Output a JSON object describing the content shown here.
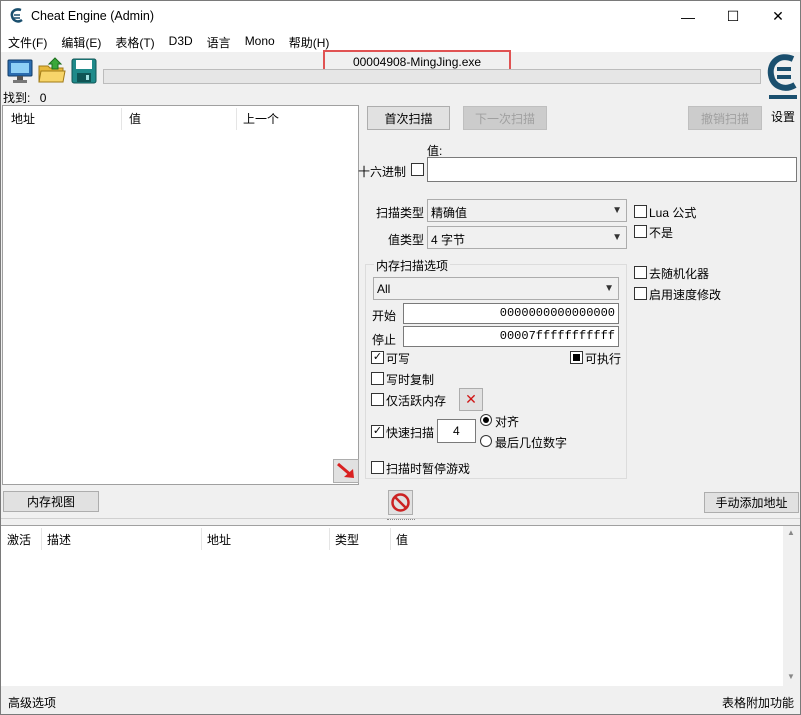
{
  "window": {
    "title": "Cheat Engine (Admin)",
    "minimize": "—",
    "maximize": "☐",
    "close": "✕"
  },
  "menu": [
    "文件(F)",
    "编辑(E)",
    "表格(T)",
    "D3D",
    "语言",
    "Mono",
    "帮助(H)"
  ],
  "process": {
    "name": "00004908-MingJing.exe"
  },
  "found": {
    "label": "找到:",
    "count": "0"
  },
  "settings_label": "设置",
  "results": {
    "columns": [
      "地址",
      "值",
      "上一个"
    ]
  },
  "scan_buttons": {
    "first": "首次扫描",
    "next": "下一次扫描",
    "undo": "撤销扫描"
  },
  "value": {
    "label": "值:",
    "hex_label": "十六进制",
    "input": ""
  },
  "scan_type": {
    "label": "扫描类型",
    "selected": "精确值"
  },
  "value_type": {
    "label": "值类型",
    "selected": "4 字节"
  },
  "right_options": {
    "lua_formula": "Lua 公式",
    "not": "不是",
    "randomizer": "去随机化器",
    "speedhack": "启用速度修改"
  },
  "memory_scan": {
    "title": "内存扫描选项",
    "region": "All",
    "start_label": "开始",
    "start_value": "0000000000000000",
    "stop_label": "停止",
    "stop_value": "00007fffffffffff",
    "writable": "可写",
    "executable": "可执行",
    "copy_on_write": "写时复制",
    "active_memory": "仅活跃内存",
    "fast_scan": "快速扫描",
    "fast_scan_value": "4",
    "align": "对齐",
    "last_digits": "最后几位数字",
    "pause_game": "扫描时暂停游戏"
  },
  "bottom_buttons": {
    "memory_view": "内存视图",
    "add_address": "手动添加地址"
  },
  "table": {
    "columns": [
      "激活",
      "描述",
      "地址",
      "类型",
      "值"
    ]
  },
  "status": {
    "left": "高级选项",
    "right": "表格附加功能"
  },
  "colors": {
    "highlight_border": "#e05252",
    "stop_icon": "#cc2222",
    "arrow": "#d92020"
  }
}
